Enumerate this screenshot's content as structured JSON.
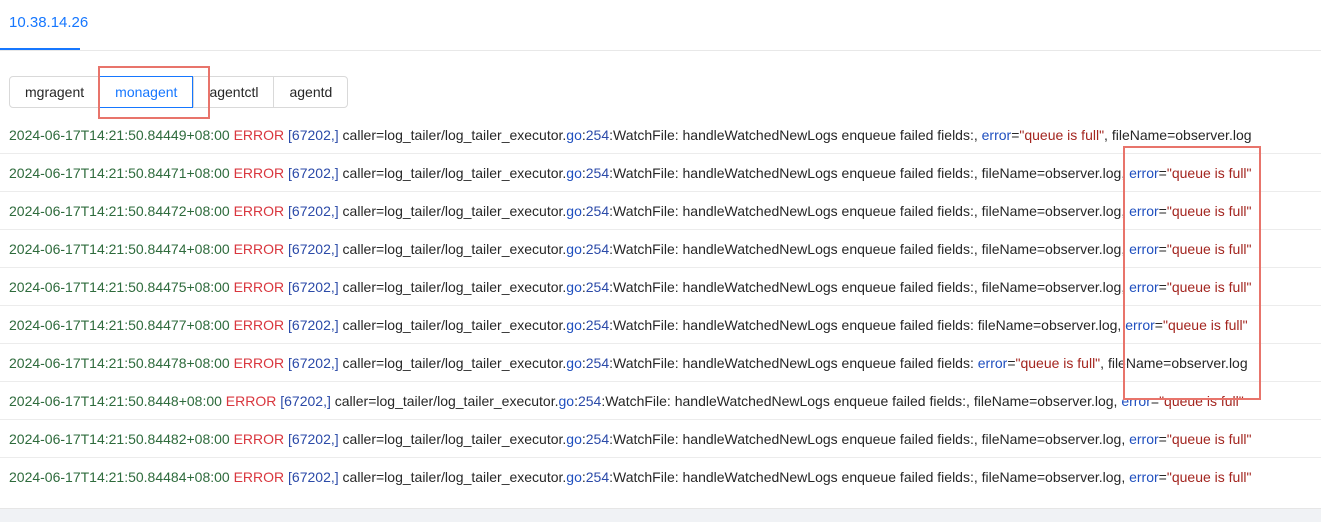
{
  "host_tab": {
    "label": "10.38.14.26"
  },
  "segments": [
    "mgragent",
    "monagent",
    "agentctl",
    "agentd"
  ],
  "active_segment": "monagent",
  "log_lines": [
    {
      "date": "2024-06-17T14:21:50.84449+08:00",
      "level": "ERROR",
      "pid": "[67202,]",
      "caller": "caller=log_tailer/log_tailer_executor.",
      "go": "go",
      "line_sep": ":",
      "line_no": "254",
      "message": ":WatchFile: handleWatchedNewLogs enqueue failed fields:, ",
      "seg1_key": "error",
      "seg1_eq": "=",
      "seg1_val": "\"queue is full\"",
      "seg1_rest": ", ",
      "seg2_text": "fileName=observer.log"
    },
    {
      "date": "2024-06-17T14:21:50.84471+08:00",
      "level": "ERROR",
      "pid": "[67202,]",
      "caller": "caller=log_tailer/log_tailer_executor.",
      "go": "go",
      "line_sep": ":",
      "line_no": "254",
      "message": ":WatchFile: handleWatchedNewLogs enqueue failed fields:, fileName=observer.log, ",
      "seg1_key": "error",
      "seg1_eq": "=",
      "seg1_val": "\"queue is full\""
    },
    {
      "date": "2024-06-17T14:21:50.84472+08:00",
      "level": "ERROR",
      "pid": "[67202,]",
      "caller": "caller=log_tailer/log_tailer_executor.",
      "go": "go",
      "line_sep": ":",
      "line_no": "254",
      "message": ":WatchFile: handleWatchedNewLogs enqueue failed fields:, fileName=observer.log, ",
      "seg1_key": "error",
      "seg1_eq": "=",
      "seg1_val": "\"queue is full\""
    },
    {
      "date": "2024-06-17T14:21:50.84474+08:00",
      "level": "ERROR",
      "pid": "[67202,]",
      "caller": "caller=log_tailer/log_tailer_executor.",
      "go": "go",
      "line_sep": ":",
      "line_no": "254",
      "message": ":WatchFile: handleWatchedNewLogs enqueue failed fields:, fileName=observer.log, ",
      "seg1_key": "error",
      "seg1_eq": "=",
      "seg1_val": "\"queue is full\""
    },
    {
      "date": "2024-06-17T14:21:50.84475+08:00",
      "level": "ERROR",
      "pid": "[67202,]",
      "caller": "caller=log_tailer/log_tailer_executor.",
      "go": "go",
      "line_sep": ":",
      "line_no": "254",
      "message": ":WatchFile: handleWatchedNewLogs enqueue failed fields:, fileName=observer.log, ",
      "seg1_key": "error",
      "seg1_eq": "=",
      "seg1_val": "\"queue is full\""
    },
    {
      "date": "2024-06-17T14:21:50.84477+08:00",
      "level": "ERROR",
      "pid": "[67202,]",
      "caller": "caller=log_tailer/log_tailer_executor.",
      "go": "go",
      "line_sep": ":",
      "line_no": "254",
      "message": ":WatchFile: handleWatchedNewLogs enqueue failed fields: fileName=observer.log, ",
      "seg1_key": "error",
      "seg1_eq": "=",
      "seg1_val": "\"queue is full\""
    },
    {
      "date": "2024-06-17T14:21:50.84478+08:00",
      "level": "ERROR",
      "pid": "[67202,]",
      "caller": "caller=log_tailer/log_tailer_executor.",
      "go": "go",
      "line_sep": ":",
      "line_no": "254",
      "message": ":WatchFile: handleWatchedNewLogs enqueue failed fields: ",
      "seg1_key": "error",
      "seg1_eq": "=",
      "seg1_val": "\"queue is full\"",
      "seg1_rest": ", ",
      "seg2_text": "fileName=observer.log"
    },
    {
      "date": "2024-06-17T14:21:50.8448+08:00",
      "level": "ERROR",
      "pid": "[67202,]",
      "caller": "caller=log_tailer/log_tailer_executor.",
      "go": "go",
      "line_sep": ":",
      "line_no": "254",
      "message": ":WatchFile: handleWatchedNewLogs enqueue failed fields:, fileName=observer.log, ",
      "seg1_key": "error",
      "seg1_eq": "=",
      "seg1_val": "\"queue is full\""
    },
    {
      "date": "2024-06-17T14:21:50.84482+08:00",
      "level": "ERROR",
      "pid": "[67202,]",
      "caller": "caller=log_tailer/log_tailer_executor.",
      "go": "go",
      "line_sep": ":",
      "line_no": "254",
      "message": ":WatchFile: handleWatchedNewLogs enqueue failed fields:, fileName=observer.log, ",
      "seg1_key": "error",
      "seg1_eq": "=",
      "seg1_val": "\"queue is full\""
    },
    {
      "date": "2024-06-17T14:21:50.84484+08:00",
      "level": "ERROR",
      "pid": "[67202,]",
      "caller": "caller=log_tailer/log_tailer_executor.",
      "go": "go",
      "line_sep": ":",
      "line_no": "254",
      "message": ":WatchFile: handleWatchedNewLogs enqueue failed fields:, fileName=observer.log, ",
      "seg1_key": "error",
      "seg1_eq": "=",
      "seg1_val": "\"queue is full\""
    }
  ],
  "colors": {
    "accent": "#1677ff",
    "date": "#2e6b3c",
    "error_level": "#d9363e",
    "key": "#1f4fbf",
    "string": "#a3251f",
    "highlight_box": "#e8746b"
  }
}
